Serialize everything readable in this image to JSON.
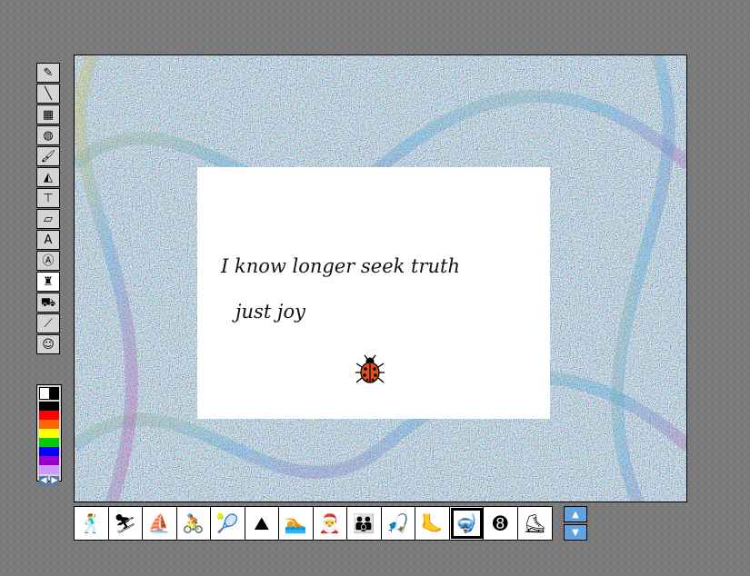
{
  "toolbar": {
    "tools": [
      {
        "name": "pencil-tool",
        "icon": "pencil-icon",
        "glyph": "✎"
      },
      {
        "name": "line-tool",
        "icon": "line-icon",
        "glyph": "╲"
      },
      {
        "name": "rectangle-tool",
        "icon": "rectangle-icon",
        "glyph": "▦"
      },
      {
        "name": "oval-tool",
        "icon": "oval-icon",
        "glyph": "◍"
      },
      {
        "name": "paintbrush-tool",
        "icon": "paintbrush-icon",
        "glyph": "🖌"
      },
      {
        "name": "paint-bucket-tool",
        "icon": "paint-bucket-icon",
        "glyph": "◭"
      },
      {
        "name": "paint-roller-tool",
        "icon": "paint-roller-icon",
        "glyph": "⊤"
      },
      {
        "name": "eraser-tool",
        "icon": "eraser-icon",
        "glyph": "▱"
      },
      {
        "name": "text-tool",
        "icon": "text-icon",
        "glyph": "A"
      },
      {
        "name": "text-stamp-tool",
        "icon": "text-stamp-icon",
        "glyph": "Ⓐ"
      },
      {
        "name": "stamp-tool",
        "icon": "stamp-icon",
        "glyph": "♜"
      },
      {
        "name": "truck-tool",
        "icon": "truck-icon",
        "glyph": "⛟"
      },
      {
        "name": "eyedropper-tool",
        "icon": "eyedropper-icon",
        "glyph": "⟋"
      },
      {
        "name": "undo-face-tool",
        "icon": "face-icon",
        "glyph": "☺"
      }
    ]
  },
  "palette": {
    "colors": [
      "#ffffff",
      "#000000",
      "#ff0000",
      "#ff6600",
      "#ffff00",
      "#00cc00",
      "#0000ff",
      "#9900cc",
      "#cc99ff"
    ]
  },
  "canvas": {
    "text": {
      "line1": "I know longer seek truth",
      "line2": "just joy"
    },
    "bug_icon": "ladybug-icon"
  },
  "stickers": [
    {
      "name": "sticker-dancer",
      "icon": "dancer-icon",
      "glyph": "🕺"
    },
    {
      "name": "sticker-skier",
      "icon": "skier-icon",
      "glyph": "⛷"
    },
    {
      "name": "sticker-windsurfer",
      "icon": "windsurfer-icon",
      "glyph": "⛵"
    },
    {
      "name": "sticker-cyclist",
      "icon": "cyclist-icon",
      "glyph": "🚴"
    },
    {
      "name": "sticker-tennis",
      "icon": "tennis-player-icon",
      "glyph": "🎾"
    },
    {
      "name": "sticker-climbers",
      "icon": "climbers-icon",
      "glyph": "⛰"
    },
    {
      "name": "sticker-swimmer",
      "icon": "swimmer-icon",
      "glyph": "🏊"
    },
    {
      "name": "sticker-santa",
      "icon": "santa-icon",
      "glyph": "🎅"
    },
    {
      "name": "sticker-family",
      "icon": "family-icon",
      "glyph": "👪"
    },
    {
      "name": "sticker-fisher",
      "icon": "fisher-icon",
      "glyph": "🎣"
    },
    {
      "name": "sticker-flippers",
      "icon": "flippers-icon",
      "glyph": "🦶"
    },
    {
      "name": "sticker-snorkel-mask",
      "icon": "snorkel-mask-icon",
      "glyph": "🤿"
    },
    {
      "name": "sticker-eight-ball",
      "icon": "eight-ball-icon",
      "glyph": "➑"
    },
    {
      "name": "sticker-speed-skier",
      "icon": "speed-skier-icon",
      "glyph": "⛸"
    }
  ],
  "selected_sticker_index": 11,
  "scroll": {
    "up_icon": "arrow-up-icon",
    "down_icon": "arrow-down-icon",
    "up_glyph": "▲",
    "down_glyph": "▼"
  }
}
